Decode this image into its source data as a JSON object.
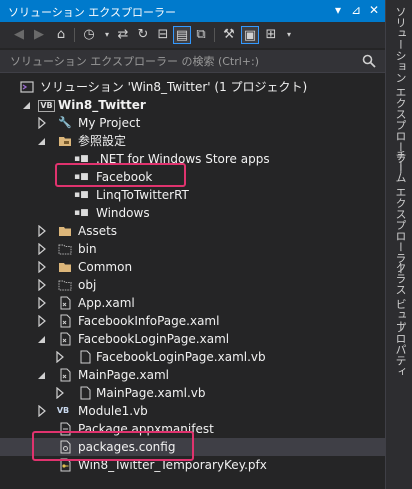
{
  "window": {
    "title": "ソリューション エクスプローラー",
    "pin_glyph": "⊿",
    "close_glyph": "✕"
  },
  "search": {
    "placeholder": "ソリューション エクスプローラー の検索 (Ctrl+:)"
  },
  "tree": {
    "solution_label": "ソリューション 'Win8_Twitter' (1 プロジェクト)",
    "project_label": "Win8_Twitter",
    "items": [
      {
        "label": "My Project"
      },
      {
        "label": "参照設定"
      },
      {
        "label": ".NET for Windows Store apps"
      },
      {
        "label": "Facebook"
      },
      {
        "label": "LinqToTwitterRT"
      },
      {
        "label": "Windows"
      },
      {
        "label": "Assets"
      },
      {
        "label": "bin"
      },
      {
        "label": "Common"
      },
      {
        "label": "obj"
      },
      {
        "label": "App.xaml"
      },
      {
        "label": "FacebookInfoPage.xaml"
      },
      {
        "label": "FacebookLoginPage.xaml"
      },
      {
        "label": "FacebookLoginPage.xaml.vb"
      },
      {
        "label": "MainPage.xaml"
      },
      {
        "label": "MainPage.xaml.vb"
      },
      {
        "label": "Module1.vb"
      },
      {
        "label": "Package.appxmanifest"
      },
      {
        "label": "packages.config"
      },
      {
        "label": "Win8_Twitter_TemporaryKey.pfx"
      }
    ]
  },
  "side_tabs": [
    {
      "label": "ソリューション エクスプローラー"
    },
    {
      "label": "チーム エクスプローラー"
    },
    {
      "label": "クラス ビュー"
    },
    {
      "label": "プロパティ"
    }
  ],
  "colors": {
    "accent": "#007acc",
    "highlight_box": "#e0336e",
    "selection": "#3f3f46"
  }
}
